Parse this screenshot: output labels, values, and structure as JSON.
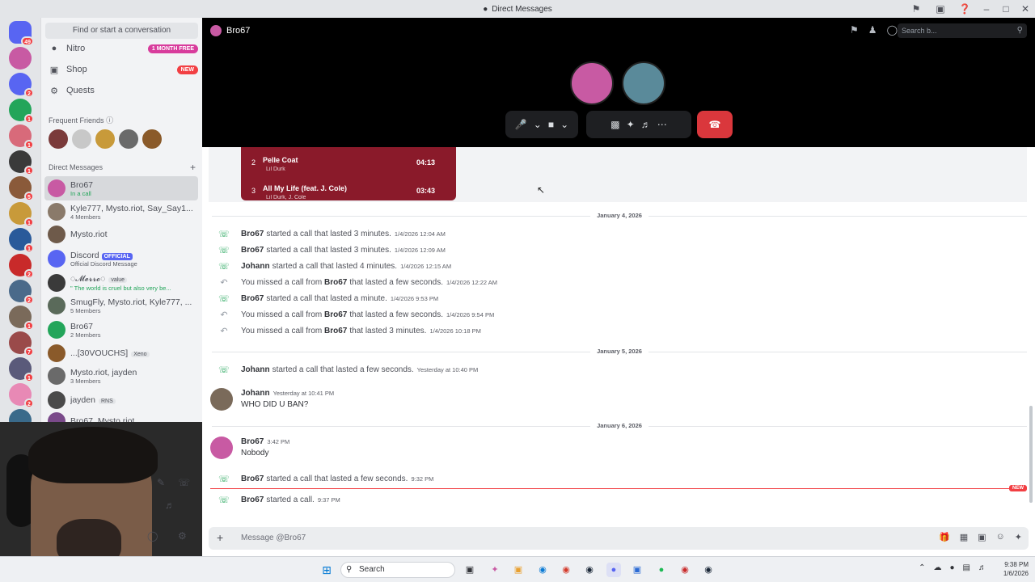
{
  "window": {
    "title": "Direct Messages"
  },
  "sidebar": {
    "search_label": "Find or start a conversation",
    "nav": [
      {
        "label": "Nitro",
        "pill": "1 MONTH FREE",
        "icon": "nitro-icon"
      },
      {
        "label": "Shop",
        "pill": "NEW",
        "icon": "shop-icon"
      },
      {
        "label": "Quests",
        "pill": "",
        "icon": "quests-icon"
      }
    ],
    "frequent_friends_label": "Frequent Friends",
    "dm_label": "Direct Messages",
    "dms": [
      {
        "name": "Bro67",
        "sub": "In a call",
        "color": "#c85aa3"
      },
      {
        "name": "Kyle777, Mysto.riot, Say_Say1...",
        "sub": "4 Members",
        "color": "#8a7a6a"
      },
      {
        "name": "Mysto.riot",
        "sub": "",
        "color": "#6e5a4a"
      },
      {
        "name": "Discord",
        "badge": "OFFICIAL",
        "sub": "Official Discord Message",
        "color": "#5865f2"
      },
      {
        "name": "◌𝓜𝓮𝓻𝓻𝓸◌",
        "tag": "value",
        "sub": "\" The world is cruel but also very be...",
        "color": "#3a3a3a"
      },
      {
        "name": "SmugFly, Mysto.riot, Kyle777, ...",
        "sub": "5 Members",
        "color": "#5a6a5a"
      },
      {
        "name": "Bro67",
        "sub": "2 Members",
        "color": "#23a55a"
      },
      {
        "name": "...[30VOUCHS]",
        "tag": "Xeno",
        "sub": "",
        "color": "#8a5a2a"
      },
      {
        "name": "Mysto.riot, jayden",
        "sub": "3 Members",
        "color": "#6a6a6a"
      },
      {
        "name": "jayden",
        "tag": "RNS",
        "sub": "",
        "color": "#4a4a4a"
      },
      {
        "name": "Bro67, Mysto.riot",
        "sub": "",
        "color": "#7a4a8a"
      }
    ]
  },
  "call": {
    "channel_name": "Bro67",
    "search_placeholder": "Search b..."
  },
  "playlist": [
    {
      "num": "2",
      "title": "Pelle Coat",
      "artist": "Lil Durk",
      "duration": "04:13"
    },
    {
      "num": "3",
      "title": "All My Life (feat. J. Cole)",
      "artist": "Lil Durk, J. Cole",
      "duration": "03:43"
    }
  ],
  "dates": {
    "d1": "January 4, 2026",
    "d2": "January 5, 2026",
    "d3": "January 6, 2026"
  },
  "calls_jan4": [
    {
      "who": "Bro67",
      "text": "started a call that lasted 3 minutes.",
      "time": "1/4/2026 12:04 AM",
      "missed": false
    },
    {
      "who": "Bro67",
      "text": "started a call that lasted 3 minutes.",
      "time": "1/4/2026 12:09 AM",
      "missed": false
    },
    {
      "who": "Johann",
      "text": "started a call that lasted 4 minutes.",
      "time": "1/4/2026 12:15 AM",
      "missed": false
    },
    {
      "pre": "You missed a call from",
      "who": "Bro67",
      "text": "that lasted a few seconds.",
      "time": "1/4/2026 12:22 AM",
      "missed": true
    },
    {
      "who": "Bro67",
      "text": "started a call that lasted a minute.",
      "time": "1/4/2026 9:53 PM",
      "missed": false
    },
    {
      "pre": "You missed a call from",
      "who": "Bro67",
      "text": "that lasted a few seconds.",
      "time": "1/4/2026 9:54 PM",
      "missed": true
    },
    {
      "pre": "You missed a call from",
      "who": "Bro67",
      "text": "that lasted 3 minutes.",
      "time": "1/4/2026 10:18 PM",
      "missed": true
    }
  ],
  "call_jan5": {
    "who": "Johann",
    "text": "started a call that lasted a few seconds.",
    "time": "Yesterday at 10:40 PM"
  },
  "msg_johann": {
    "author": "Johann",
    "time": "Yesterday at 10:41 PM",
    "body": "WHO DID U BAN?"
  },
  "msg_bro": {
    "author": "Bro67",
    "time": "3:42 PM",
    "body": "Nobody"
  },
  "call_jan6a": {
    "who": "Bro67",
    "text": "started a call that lasted a few seconds.",
    "time": "9:32 PM"
  },
  "call_jan6b": {
    "who": "Bro67",
    "text": "started a call.",
    "time": "9:37 PM"
  },
  "new_label": "NEW",
  "composer": {
    "placeholder": "Message @Bro67"
  },
  "taskbar": {
    "search": "Search",
    "time": "9:38 PM",
    "date": "1/6/2026"
  },
  "rail_badges": [
    "49",
    "",
    "2",
    "1",
    "1",
    "1",
    "5",
    "1",
    "1",
    "2",
    "2",
    "1",
    "7",
    "1",
    "2",
    "1",
    "3"
  ]
}
